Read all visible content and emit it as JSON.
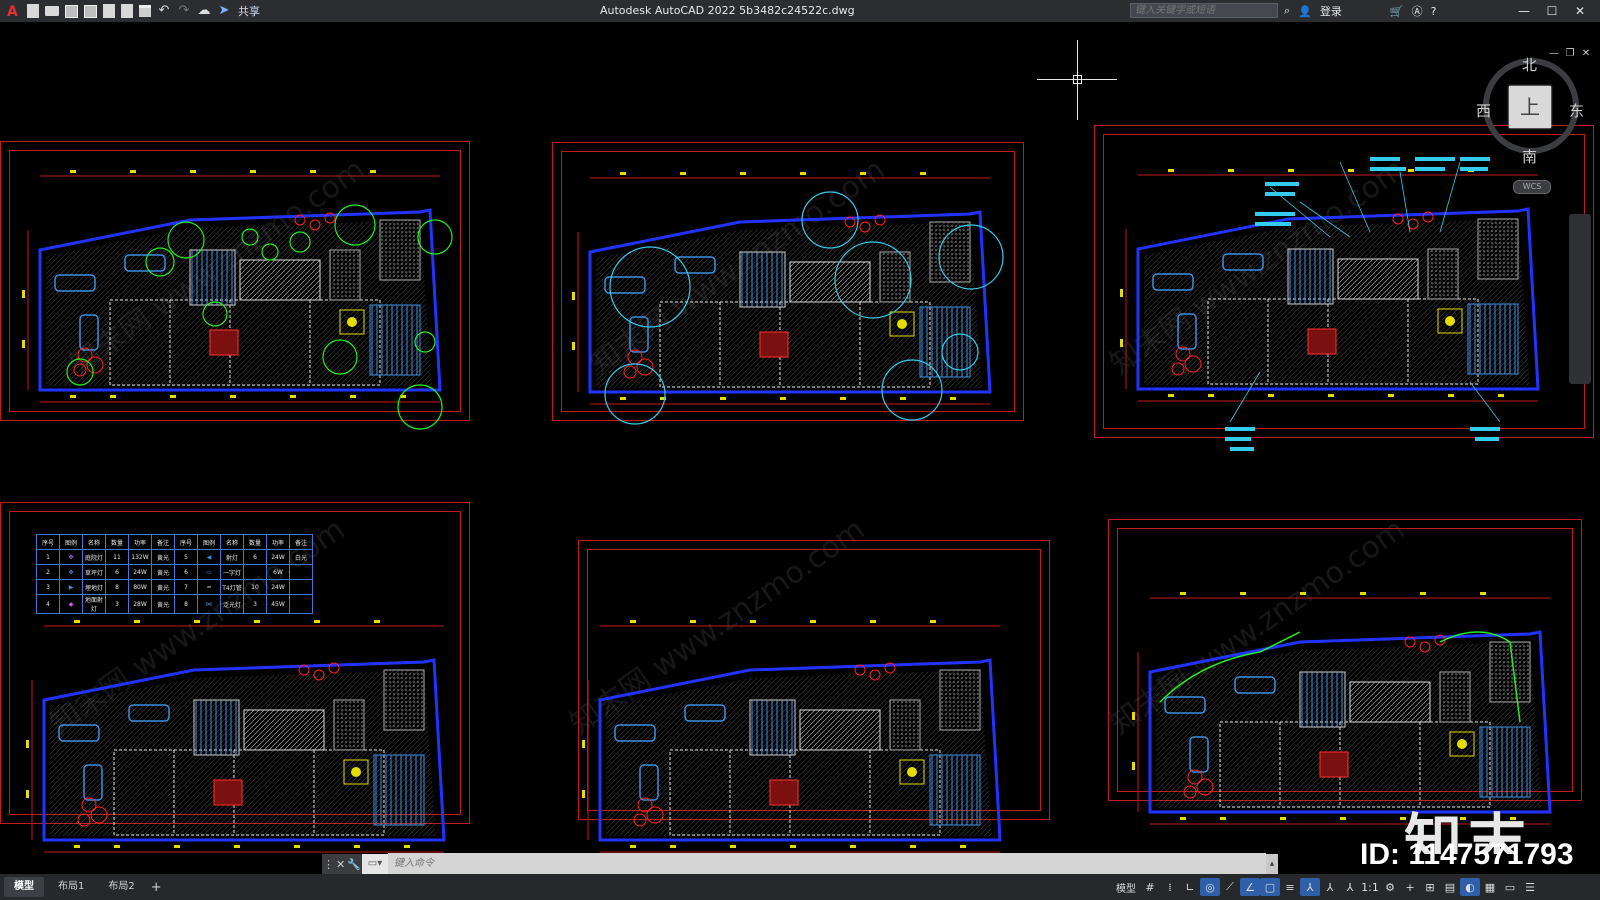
{
  "titlebar": {
    "app_title": "Autodesk AutoCAD 2022    5b3482c24522c.dwg",
    "share_label": "共享",
    "search_placeholder": "键入关键字或短语",
    "login_label": "登录"
  },
  "viewcube": {
    "face_label": "上",
    "north": "北",
    "south": "南",
    "east": "东",
    "west": "西",
    "wcs_label": "WCS"
  },
  "legend_table": {
    "header": [
      "序号",
      "图例",
      "名称",
      "数量",
      "功率",
      "备注",
      "序号",
      "图例",
      "名称",
      "数量",
      "功率",
      "备注"
    ],
    "rows": [
      [
        "1",
        "",
        "庭院灯",
        "11",
        "132W",
        "黄光",
        "5",
        "",
        "射灯",
        "6",
        "24W",
        "白光"
      ],
      [
        "2",
        "",
        "草坪灯",
        "6",
        "24W",
        "黄光",
        "6",
        "",
        "一字灯",
        "",
        "6W",
        ""
      ],
      [
        "3",
        "",
        "埋地灯",
        "8",
        "80W",
        "黄光",
        "7",
        "",
        "T4灯管",
        "10",
        "24W",
        ""
      ],
      [
        "4",
        "",
        "地面射灯",
        "3",
        "28W",
        "黄光",
        "8",
        "",
        "泛光灯",
        "3",
        "45W",
        ""
      ]
    ]
  },
  "command": {
    "placeholder": "键入命令"
  },
  "statusbar": {
    "tabs": [
      "模型",
      "布局1",
      "布局2"
    ],
    "model_label": "模型",
    "scale_label": "1:1"
  },
  "watermark": {
    "brand": "知末",
    "id_text": "ID: 1147571793"
  },
  "colors": {
    "frame": "#c21a1a",
    "wall": "#2233ff",
    "plant": "#22ee22",
    "cyan": "#33ccee",
    "accent": "#e6dd00"
  }
}
